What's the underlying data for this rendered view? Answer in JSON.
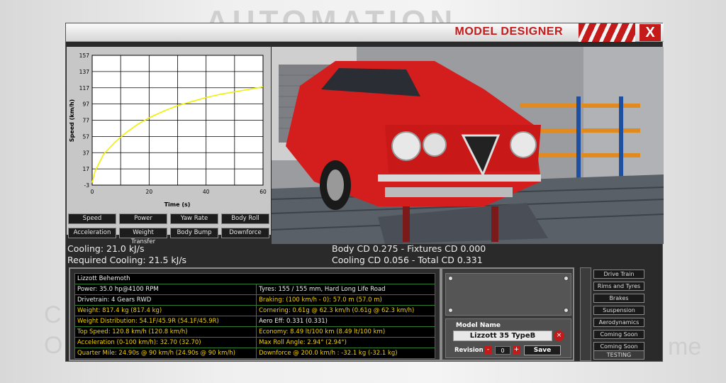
{
  "window": {
    "title": "MODEL DESIGNER",
    "close_label": "X"
  },
  "background": {
    "logo_text": "AUTOMATION",
    "ghost_left_1": "C",
    "ghost_left_2": "O",
    "ghost_right": "me"
  },
  "graph": {
    "chart_data": {
      "type": "line",
      "xlabel": "Time (s)",
      "ylabel": "Speed (km/h)",
      "x_ticks": [
        "0",
        "20",
        "40",
        "60"
      ],
      "y_ticks": [
        "157",
        "137",
        "117",
        "97",
        "77",
        "57",
        "37",
        "17",
        "-3"
      ],
      "xlim": [
        0,
        60
      ],
      "ylim": [
        -3,
        157
      ],
      "series": [
        {
          "color": "#f0f000",
          "x": [
            0,
            1,
            4,
            8,
            12,
            16,
            20,
            25,
            30,
            35,
            40,
            45,
            50,
            55,
            60
          ],
          "y": [
            0,
            14,
            35,
            50,
            62,
            72,
            80,
            88,
            95,
            100,
            105,
            109,
            112,
            115,
            118
          ]
        }
      ]
    },
    "buttons": [
      "Speed",
      "Power",
      "Yaw Rate",
      "Body Roll",
      "Acceleration",
      "Weight Transfer",
      "Body Bump",
      "Downforce"
    ]
  },
  "stats": {
    "cooling": "Cooling: 21.0 kJ/s",
    "required_cooling": "Required Cooling: 21.5 kJ/s",
    "body_cd": "Body CD 0.275 - Fixtures CD 0.000",
    "cooling_cd": "Cooling CD 0.056 - Total CD 0.331"
  },
  "info_table": {
    "title": "Lizzott Behemoth",
    "rows": [
      [
        "Power: 35.0 hp@4100 RPM",
        "Tyres: 155 / 155 mm, Hard Long Life Road"
      ],
      [
        "Drivetrain: 4 Gears RWD",
        "Braking: (100 km/h - 0): 57.0 m (57.0 m)"
      ],
      [
        "Weight: 817.4 kg (817.4 kg)",
        "Cornering: 0.61g @ 62.3 km/h (0.61g @ 62.3 km/h)"
      ],
      [
        "Weight Distribution: 54.1F/45.9R (54.1F/45.9R)",
        "Aero Eff: 0.331 (0.331)"
      ],
      [
        "Top Speed: 120.8 km/h (120.8 km/h)",
        "Economy: 8.49 lt/100 km (8.49 lt/100 km)"
      ],
      [
        "Acceleration (0-100 km/h): 32.70 (32.70)",
        "Max Roll Angle: 2.94° (2.94°)"
      ],
      [
        "Quarter Mile: 24.90s @ 90 km/h (24.90s @ 90 km/h)",
        "Downforce @ 200.0 km/h : -32.1 kg (-32.1 kg)"
      ]
    ]
  },
  "model": {
    "label": "Model Name",
    "name": "Lizzott 35 TypeB",
    "revision_label": "Revision",
    "revision": "0",
    "save_label": "Save",
    "minus": "-",
    "plus": "+",
    "clear": "×"
  },
  "tabs": [
    "Drive Train",
    "Rims and Tyres",
    "Brakes",
    "Suspension",
    "Aerodynamics",
    "Coming Soon",
    "Coming Soon",
    "TESTING"
  ],
  "icons": {
    "camera": "camera-icon",
    "eye": "eye-icon",
    "scroll_up": "arrow-up-icon",
    "scroll_down": "arrow-down-icon",
    "hide": "eye-hide-icon"
  },
  "colors": {
    "accent": "#c41a1a",
    "graph_line": "#f0f000",
    "highlight_text": "#f0d000",
    "table_border": "#2f7d2f"
  }
}
